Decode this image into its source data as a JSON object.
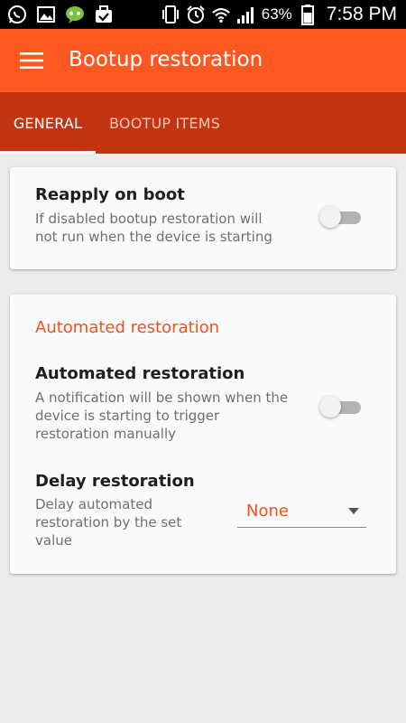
{
  "status_bar": {
    "icons_left": [
      "whatsapp-icon",
      "gallery-icon",
      "chat-icon",
      "briefcase-check-icon"
    ],
    "icons_right": [
      "vibrate-icon",
      "alarm-icon",
      "wifi-icon",
      "signal-icon",
      "battery-icon"
    ],
    "battery_percent": "63%",
    "time": "7:58 PM"
  },
  "app_bar": {
    "menu_icon": "menu-icon",
    "title": "Bootup restoration",
    "color": "#ff5722"
  },
  "tabs": [
    {
      "label": "GENERAL",
      "selected": true
    },
    {
      "label": "BOOTUP ITEMS",
      "selected": false
    }
  ],
  "card_reapply": {
    "title": "Reapply on boot",
    "desc_line1": "If disabled bootup restoration will",
    "desc_line2": "not run when the device is starting",
    "enabled": false
  },
  "card_automated": {
    "section_title": "Automated restoration",
    "automated": {
      "title": "Automated restoration",
      "desc_line1": "A notification will be shown when the",
      "desc_line2": "device is starting to trigger",
      "desc_line3": "restoration manually",
      "enabled": false
    },
    "delay": {
      "title": "Delay restoration",
      "desc_line1": "Delay automated",
      "desc_line2": "restoration by the set",
      "desc_line3": "value",
      "selected_value": "None"
    }
  },
  "colors": {
    "accent": "#f4511e",
    "tab_bar": "#c13512",
    "background": "#ececec"
  }
}
